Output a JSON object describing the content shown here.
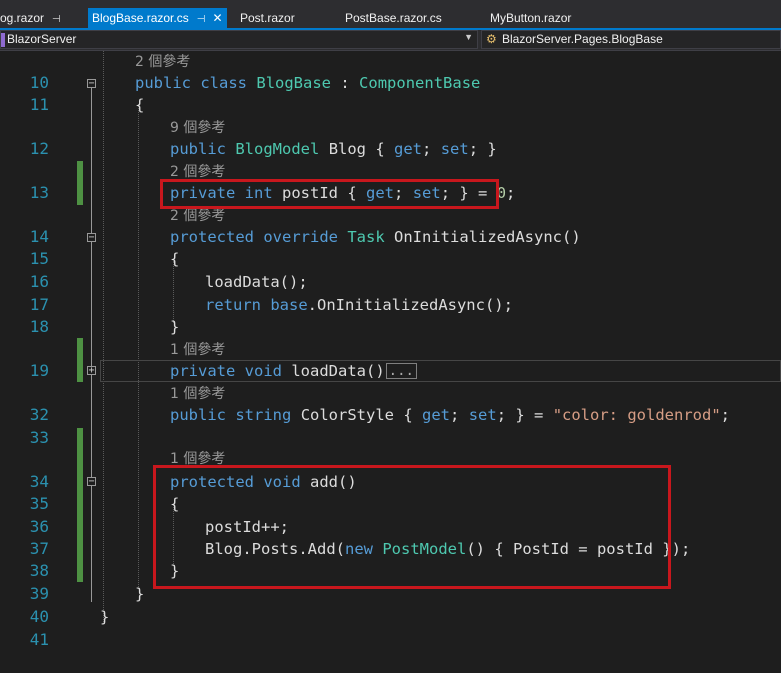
{
  "tabs": [
    {
      "label": "og.razor",
      "pinned": true,
      "active": false
    },
    {
      "label": "BlogBase.razor.cs",
      "pinned": true,
      "active": true
    },
    {
      "label": "Post.razor",
      "pinned": false,
      "active": false
    },
    {
      "label": "PostBase.razor.cs",
      "pinned": false,
      "active": false
    },
    {
      "label": "MyButton.razor",
      "pinned": false,
      "active": false
    }
  ],
  "nav": {
    "project": "BlazorServer",
    "member": "BlazorServer.Pages.BlogBase"
  },
  "lines": [
    {
      "n": "10"
    },
    {
      "n": "11"
    },
    {
      "n": "12"
    },
    {
      "n": "13"
    },
    {
      "n": "14"
    },
    {
      "n": "15"
    },
    {
      "n": "16"
    },
    {
      "n": "17"
    },
    {
      "n": "18"
    },
    {
      "n": "19"
    },
    {
      "n": "32"
    },
    {
      "n": "33"
    },
    {
      "n": "34"
    },
    {
      "n": "35"
    },
    {
      "n": "36"
    },
    {
      "n": "37"
    },
    {
      "n": "38"
    },
    {
      "n": "39"
    },
    {
      "n": "40"
    },
    {
      "n": "41"
    }
  ],
  "lens": [
    "2 個參考",
    "9 個參考",
    "2 個參考",
    "2 個參考",
    "1 個參考",
    "1 個參考",
    "1 個參考"
  ],
  "code": {
    "l10": [
      "public",
      "class",
      "BlogBase",
      ":",
      "ComponentBase"
    ],
    "l11": "{",
    "l12": [
      "public",
      "BlogModel",
      "Blog { ",
      "get",
      "; ",
      "set",
      "; }"
    ],
    "l13": [
      "private",
      "int",
      "postId { ",
      "get",
      "; ",
      "set",
      "; } = ",
      "0",
      ";"
    ],
    "l14": [
      "protected",
      "override",
      "Task",
      "OnInitializedAsync()"
    ],
    "l15": "{",
    "l16": "loadData();",
    "l17": [
      "return",
      "base",
      ".OnInitializedAsync();"
    ],
    "l18": "}",
    "l19": [
      "private",
      "void",
      "loadData()",
      "..."
    ],
    "l32": [
      "public",
      "string",
      "ColorStyle { ",
      "get",
      "; ",
      "set",
      "; } = ",
      "\"color: goldenrod\"",
      ";"
    ],
    "l34": [
      "protected",
      "void",
      "add()"
    ],
    "l35": "{",
    "l36": "postId++;",
    "l37": [
      "Blog.Posts.Add(",
      "new",
      "PostModel",
      "() { PostId = postId });"
    ],
    "l38": "}",
    "l39": "}",
    "l40": "}"
  },
  "colors": {
    "keyword": "#569cd6",
    "type": "#4ec9b0",
    "string": "#d69d85",
    "number": "#b5cea8",
    "line_number": "#2b91af",
    "highlight_box": "#c8171d",
    "change_bar": "#57a64a"
  }
}
